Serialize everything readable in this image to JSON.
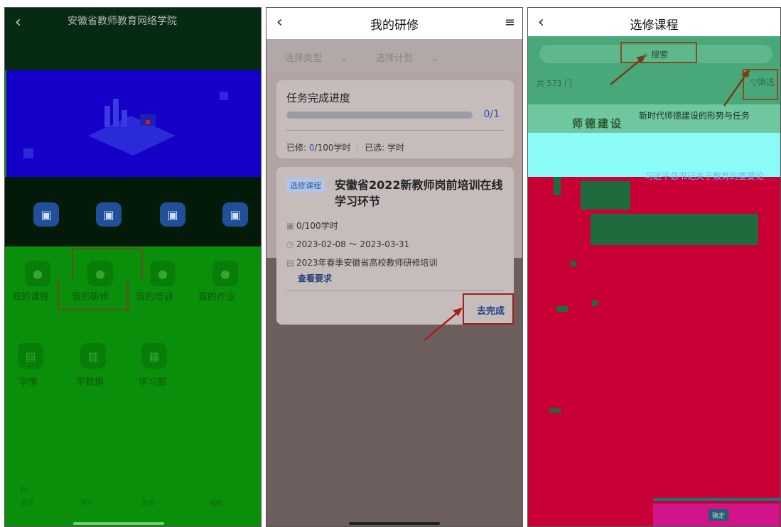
{
  "panel1": {
    "title": "安徽省教师教育网络学院",
    "icon_row1": [
      "▣",
      "▣",
      "▣",
      "▣"
    ],
    "menu_labels": [
      "我的课程",
      "我的研修",
      "我的培训",
      "我的作业"
    ],
    "icon_row2": [
      "▤",
      "▥",
      "▦"
    ],
    "menu_labels2": [
      "学情",
      "学数据",
      "学习圈"
    ],
    "nav_labels": [
      "首页",
      "学习",
      "消息",
      "我的"
    ]
  },
  "panel2": {
    "header_title": "我的研修",
    "filter_type": "选择类型",
    "filter_plan": "选择计划",
    "progress_title": "任务完成进度",
    "progress_value": "0/1",
    "progress_fraction": 0,
    "stat_done_label": "已修:",
    "stat_done_value": "0",
    "stat_done_total": "/100学时",
    "stat_selected": "已选: 学时",
    "tag": "选修课程",
    "course_title": "安徽省2022新教师岗前培训在线学习环节",
    "hours": "0/100学时",
    "dates": "2023-02-08 ～ 2023-03-31",
    "project": "2023年春季安徽省高校教师研修培训",
    "requirements_link": "查看要求",
    "complete_button": "去完成"
  },
  "panel3": {
    "header_title": "选修课程",
    "search_placeholder": "搜索",
    "count": "共 573 门",
    "filter": "筛选",
    "course1_title": "新时代师德建设的形势与任务",
    "course2_title": "习近平总书记关于教育的重要论",
    "seal_text": "师德建设",
    "bottom_button": "确定"
  }
}
